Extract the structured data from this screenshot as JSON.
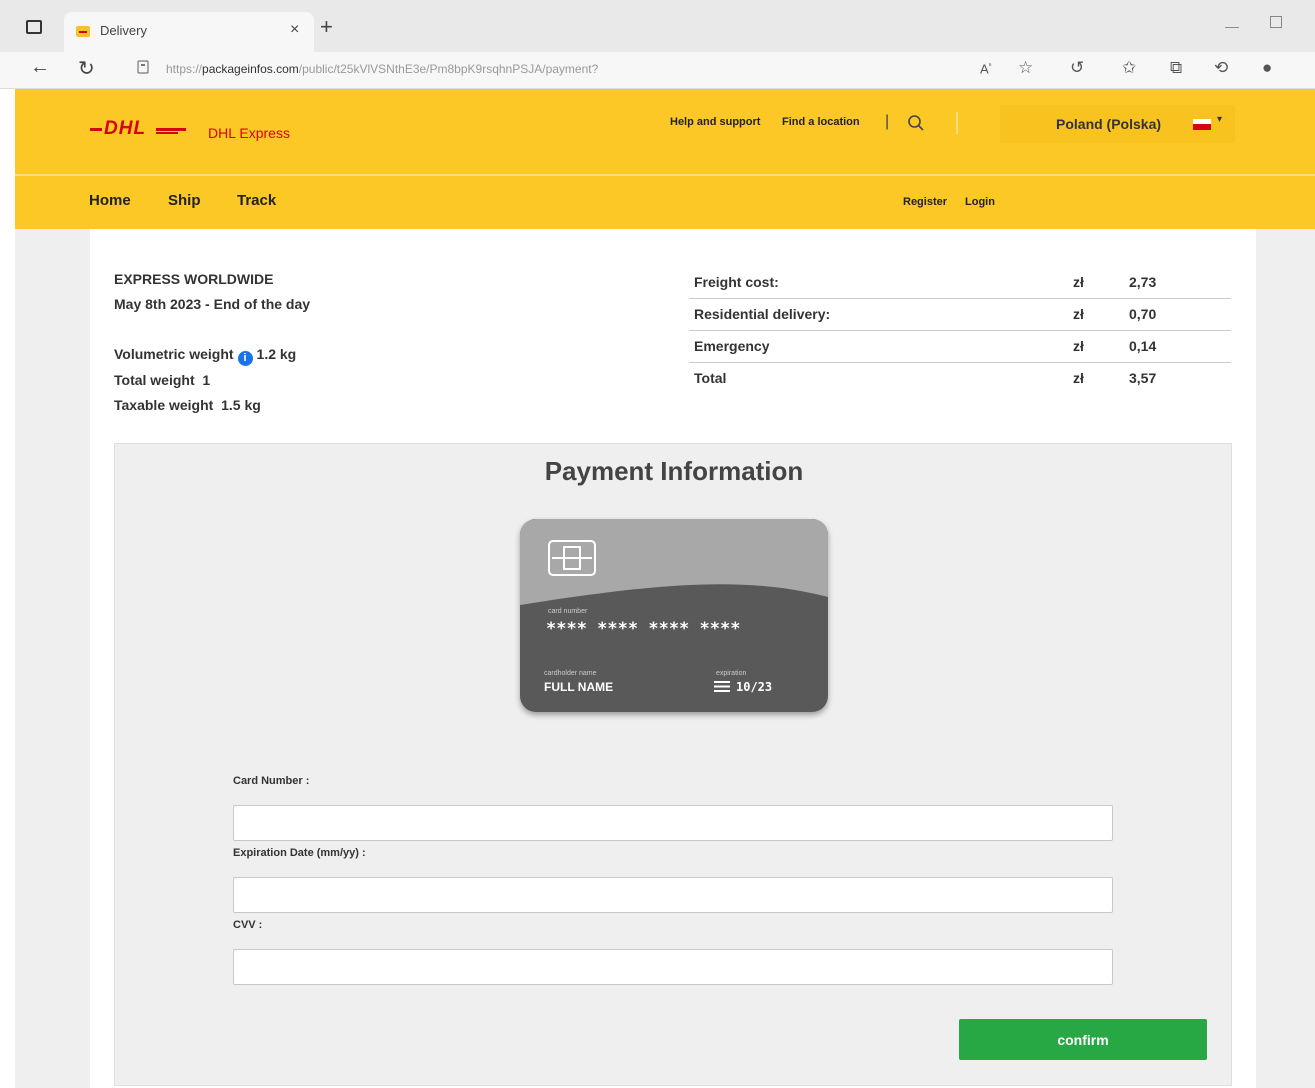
{
  "browser": {
    "tab_title": "Delivery",
    "tab_close": "×",
    "new_tab": "+",
    "url_prefix": "https://",
    "url_host": "packageinfos.com",
    "url_path": "/public/t25kVlVSNthE3e/Pm8bpK9rsqhnPSJA/payment?"
  },
  "header": {
    "brand_subtitle": "DHL Express",
    "help_link": "Help and support",
    "location_link": "Find a location",
    "country": "Poland (Polska)",
    "nav": {
      "home": "Home",
      "ship": "Ship",
      "track": "Track"
    },
    "register": "Register",
    "login": "Login"
  },
  "shipment": {
    "service": "EXPRESS WORLDWIDE",
    "delivery": "May 8th 2023 - End of the day",
    "volumetric_label": "Volumetric weight",
    "volumetric_value": "1.2 kg",
    "total_weight_label": "Total weight",
    "total_weight_value": "1",
    "taxable_label": "Taxable weight",
    "taxable_value": "1.5 kg"
  },
  "costs": [
    {
      "label": "Freight cost:",
      "currency": "zł",
      "amount": "2,73"
    },
    {
      "label": "Residential delivery:",
      "currency": "zł",
      "amount": "0,70"
    },
    {
      "label": "Emergency",
      "currency": "zł",
      "amount": "0,14"
    },
    {
      "label": "Total",
      "currency": "zł",
      "amount": "3,57"
    }
  ],
  "payment": {
    "title": "Payment Information",
    "card": {
      "number_label": "card number",
      "number": "**** **** **** ****",
      "holder_label": "cardholder name",
      "holder": "FULL NAME",
      "exp_label": "expiration",
      "exp": "10/23"
    },
    "card_number_label": "Card Number :",
    "card_number_value": "",
    "expiration_label": "Expiration Date (mm/yy) :",
    "expiration_value": "",
    "cvv_label": "CVV :",
    "cvv_value": "",
    "confirm_label": "confirm"
  },
  "colors": {
    "dhl_yellow": "#fcc826",
    "dhl_red": "#d40511",
    "confirm_green": "#28a745",
    "card_gray": "#595959"
  }
}
